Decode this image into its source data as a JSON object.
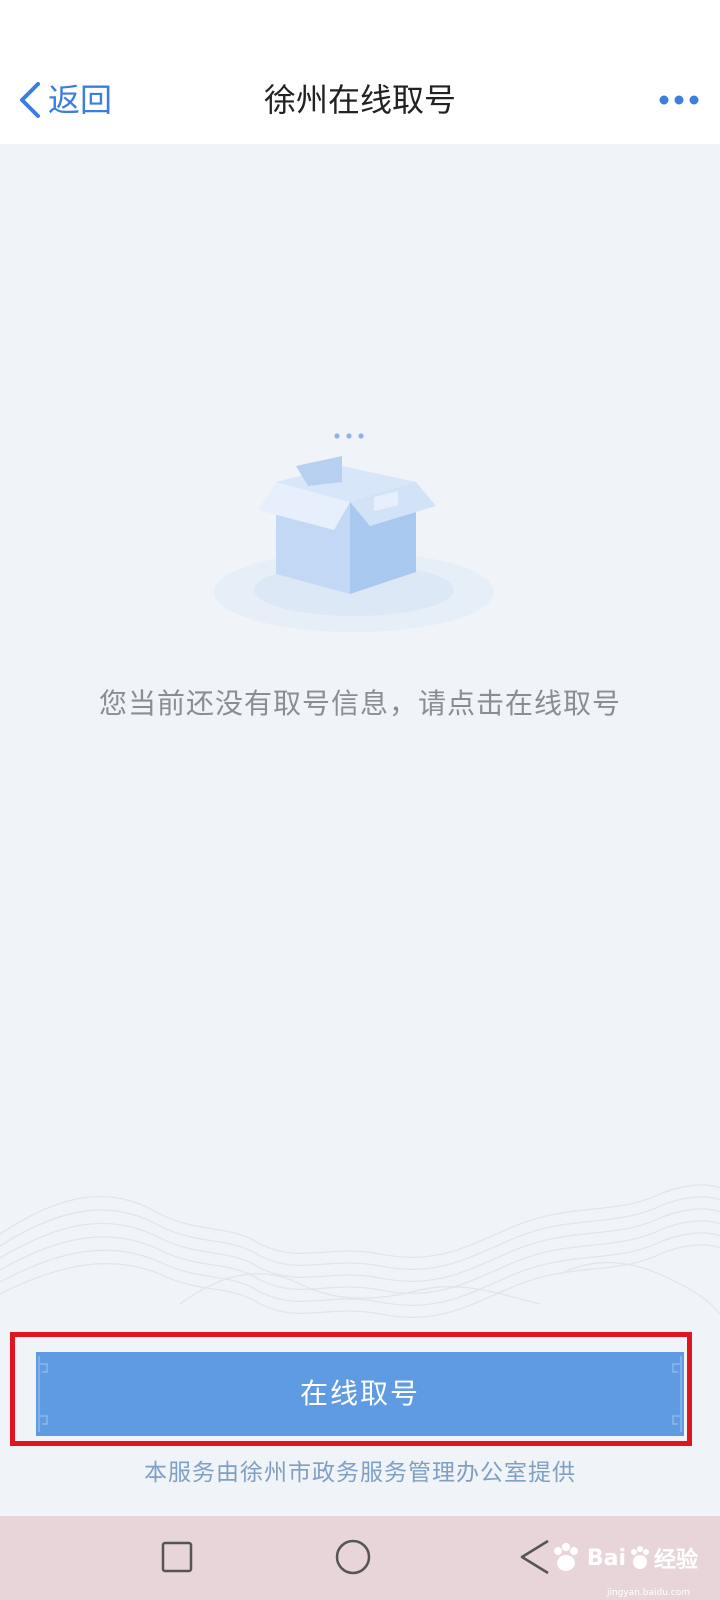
{
  "header": {
    "back_label": "返回",
    "title": "徐州在线取号",
    "accent_color": "#3b7ee0"
  },
  "empty_state": {
    "illustration": "empty-box-icon",
    "message": "您当前还没有取号信息，请点击在线取号"
  },
  "action": {
    "button_label": "在线取号",
    "button_color": "#5f9be3",
    "highlight_color": "#e0151d"
  },
  "footer": {
    "provider_note": "本服务由徐州市政务服务管理办公室提供"
  },
  "system_nav": {
    "buttons": [
      "recent-apps-icon",
      "home-icon",
      "back-triangle-icon"
    ],
    "background": "#e8d5d9"
  },
  "watermark": {
    "brand": "Bai",
    "brand_suffix": "经验",
    "url": "jingyan.baidu.com"
  }
}
